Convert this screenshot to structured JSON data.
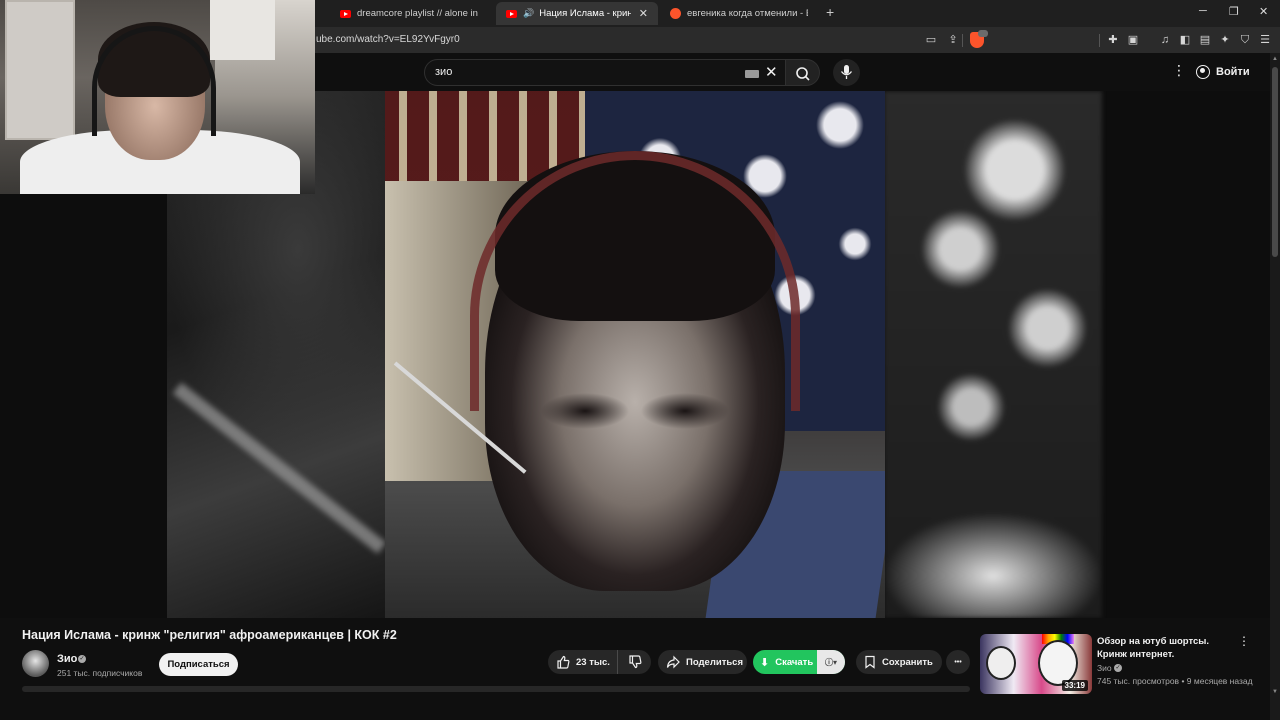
{
  "browser": {
    "tabs": [
      {
        "title": "dreamcore playlist // alone in such a",
        "active": false,
        "icon": "youtube-icon"
      },
      {
        "title": "Нация Ислама - кринж \"рел",
        "active": true,
        "icon": "youtube-icon"
      },
      {
        "title": "евгеника когда отменили - Brave Se",
        "active": false,
        "icon": "brave-icon"
      }
    ],
    "new_tab_glyph": "+",
    "window_controls": {
      "minimize": "─",
      "restore": "❐",
      "close": "✕"
    },
    "url": "ube.com/watch?v=EL92YvFgyr0"
  },
  "youtube": {
    "search": {
      "value": "зио",
      "clear_glyph": "✕"
    },
    "menu_glyph": "⋮",
    "signin_label": "Войти"
  },
  "video": {
    "title": "Нация Ислама - кринж \"религия\" афроамериканцев | КОК #2",
    "channel": {
      "name": "Зио",
      "subscribers": "251 тыс. подписчиков",
      "verified_glyph": "✓"
    },
    "subscribe_label": "Подписаться",
    "actions": {
      "likes": "23 тыс.",
      "share_label": "Поделиться",
      "download_label": "Скачать",
      "save_label": "Сохранить",
      "more_glyph": "•••"
    }
  },
  "recommendation": {
    "title": "Обзор на ютуб шортсы. Кринж интернет.",
    "channel": "Зио",
    "views": "745 тыс. просмотров",
    "age": "9 месяцев назад",
    "duration": "33:19",
    "menu_glyph": "⋮"
  }
}
